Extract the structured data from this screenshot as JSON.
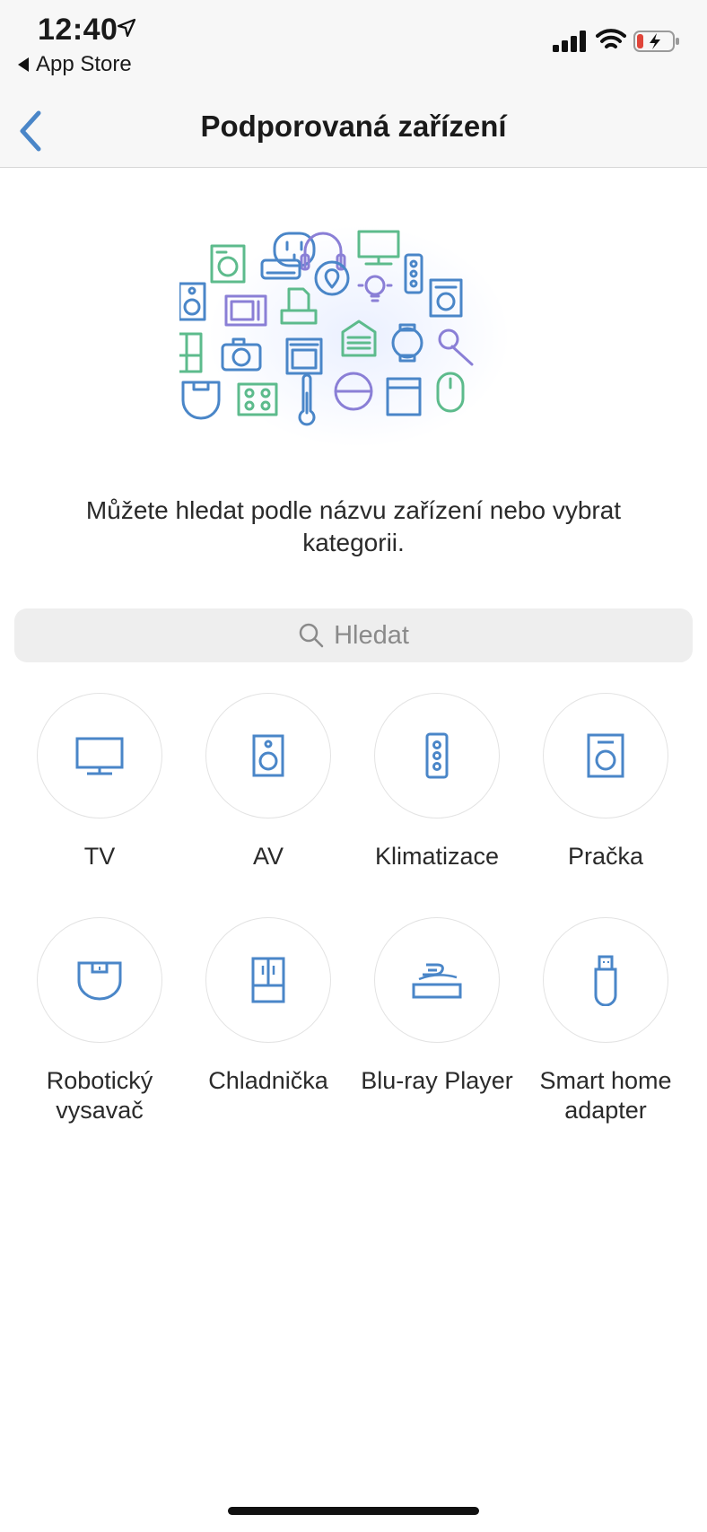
{
  "status_bar": {
    "time": "12:40",
    "back_app_label": "App Store"
  },
  "navbar": {
    "title": "Podporovaná zařízení"
  },
  "intro": {
    "text": "Můžete hledat podle názvu zařízení nebo vybrat kategorii."
  },
  "search": {
    "placeholder": "Hledat"
  },
  "categories": [
    {
      "label": "TV",
      "icon": "tv-icon"
    },
    {
      "label": "AV",
      "icon": "speaker-icon"
    },
    {
      "label": "Klimatizace",
      "icon": "air-conditioner-icon"
    },
    {
      "label": "Pračka",
      "icon": "washing-machine-icon"
    },
    {
      "label": "Robotický vysavač",
      "icon": "robot-vacuum-icon"
    },
    {
      "label": "Chladnička",
      "icon": "refrigerator-icon"
    },
    {
      "label": "Blu-ray Player",
      "icon": "bluray-player-icon"
    },
    {
      "label": "Smart home adapter",
      "icon": "usb-adapter-icon"
    }
  ],
  "colors": {
    "accent_blue": "#4a86c8",
    "icon_green": "#5dbb8c",
    "icon_purple": "#8a7fd6",
    "nav_background": "#f7f7f7"
  }
}
